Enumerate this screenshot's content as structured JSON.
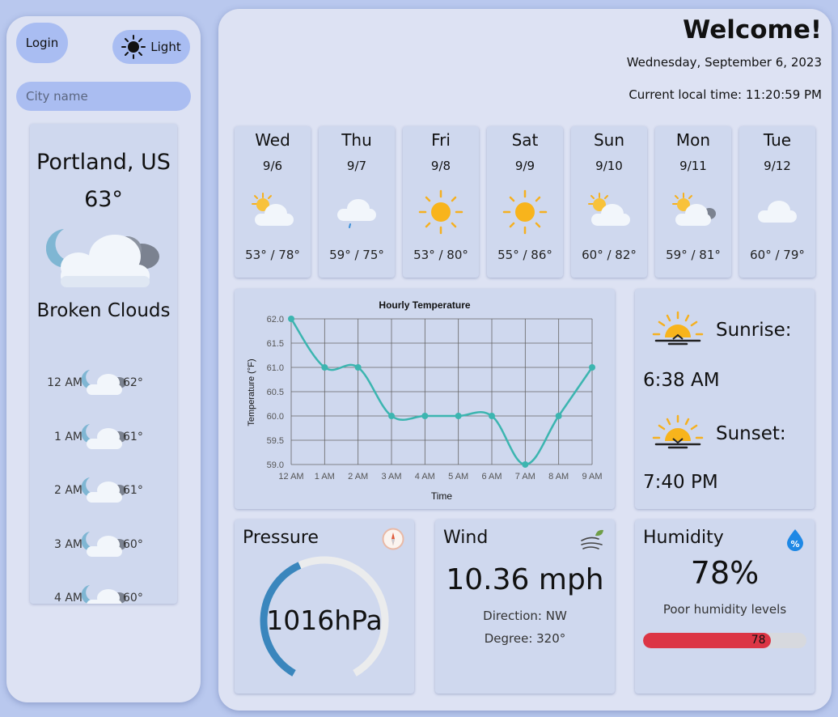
{
  "sidebar": {
    "login_label": "Login",
    "theme_label": "Light",
    "city_placeholder": "City name",
    "current": {
      "city": "Portland, US",
      "temp": "63°",
      "description": "Broken Clouds",
      "icon": "night-broken-clouds-icon"
    },
    "hourly": [
      {
        "time": "12 AM",
        "temp": "62°"
      },
      {
        "time": "1 AM",
        "temp": "61°"
      },
      {
        "time": "2 AM",
        "temp": "61°"
      },
      {
        "time": "3 AM",
        "temp": "60°"
      },
      {
        "time": "4 AM",
        "temp": "60°"
      }
    ]
  },
  "header": {
    "welcome": "Welcome!",
    "date": "Wednesday, September 6, 2023",
    "local_time": "Current local time: 11:20:59 PM"
  },
  "forecast": [
    {
      "day": "Wed",
      "date": "9/6",
      "range": "53° / 78°",
      "icon": "sun-behind-cloud-icon"
    },
    {
      "day": "Thu",
      "date": "9/7",
      "range": "59° / 75°",
      "icon": "light-rain-cloud-icon"
    },
    {
      "day": "Fri",
      "date": "9/8",
      "range": "53° / 80°",
      "icon": "sun-icon"
    },
    {
      "day": "Sat",
      "date": "9/9",
      "range": "55° / 86°",
      "icon": "sun-icon"
    },
    {
      "day": "Sun",
      "date": "9/10",
      "range": "60° / 82°",
      "icon": "sun-behind-cloud-icon"
    },
    {
      "day": "Mon",
      "date": "9/11",
      "range": "59° / 81°",
      "icon": "sun-behind-dark-cloud-icon"
    },
    {
      "day": "Tue",
      "date": "9/12",
      "range": "60° / 79°",
      "icon": "cloud-icon"
    }
  ],
  "chart_data": {
    "type": "line",
    "title": "Hourly Temperature",
    "xlabel": "Time",
    "ylabel": "Temperature (°F)",
    "categories": [
      "12 AM",
      "1 AM",
      "2 AM",
      "3 AM",
      "4 AM",
      "5 AM",
      "6 AM",
      "7 AM",
      "8 AM",
      "9 AM"
    ],
    "series": [
      {
        "values": [
          62.0,
          61.0,
          61.0,
          60.0,
          60.0,
          60.0,
          60.0,
          59.0,
          60.0,
          61.0
        ],
        "color": "#3cb5b0"
      }
    ],
    "ylim": [
      59.0,
      62.0
    ],
    "yticks": [
      "62.0",
      "61.5",
      "61.0",
      "60.5",
      "60.0",
      "59.5",
      "59.0"
    ],
    "grid": true
  },
  "sun": {
    "sunrise_label": "Sunrise:",
    "sunrise_time": "6:38 AM",
    "sunset_label": "Sunset:",
    "sunset_time": "7:40 PM"
  },
  "pressure": {
    "title": "Pressure",
    "value": "1016hPa",
    "gauge_fraction": 0.42,
    "gauge_color": "#3a86bd"
  },
  "wind": {
    "title": "Wind",
    "speed": "10.36 mph",
    "direction": "Direction: NW",
    "degree": "Degree: 320°"
  },
  "humidity": {
    "title": "Humidity",
    "value": "78%",
    "note": "Poor humidity levels",
    "bar_value": "78",
    "bar_percent": 78,
    "bar_color": "#dc3545"
  }
}
